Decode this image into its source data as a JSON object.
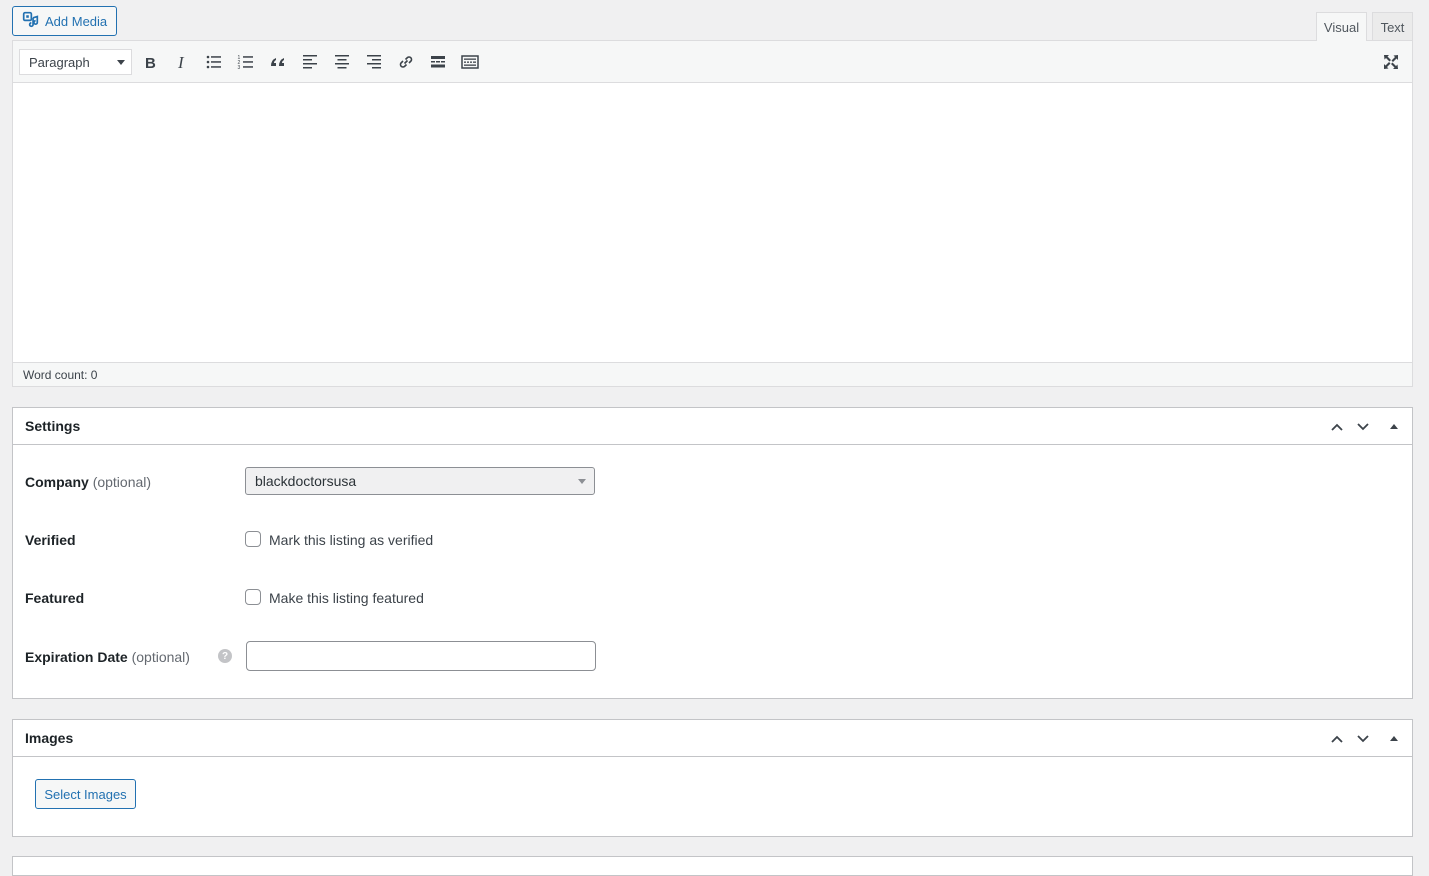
{
  "editor": {
    "add_media_label": "Add Media",
    "tabs": {
      "visual": "Visual",
      "text": "Text"
    },
    "format_select": "Paragraph",
    "toolbar_icons": [
      "bold-icon",
      "italic-icon",
      "bullet-list-icon",
      "numbered-list-icon",
      "blockquote-icon",
      "align-left-icon",
      "align-center-icon",
      "align-right-icon",
      "link-icon",
      "read-more-icon",
      "toolbar-toggle-icon",
      "fullscreen-icon"
    ],
    "status": "Word count: 0"
  },
  "settings": {
    "title": "Settings",
    "company": {
      "label": "Company",
      "optional": "(optional)",
      "value": "blackdoctorsusa"
    },
    "verified": {
      "label": "Verified",
      "checkbox_label": "Mark this listing as verified"
    },
    "featured": {
      "label": "Featured",
      "checkbox_label": "Make this listing featured"
    },
    "expiration": {
      "label": "Expiration Date",
      "optional": "(optional)",
      "help": "?",
      "value": ""
    }
  },
  "images": {
    "title": "Images",
    "select_button": "Select Images"
  },
  "colors": {
    "accent": "#2271b1",
    "background": "#f0f0f1",
    "border": "#c3c4c7"
  }
}
